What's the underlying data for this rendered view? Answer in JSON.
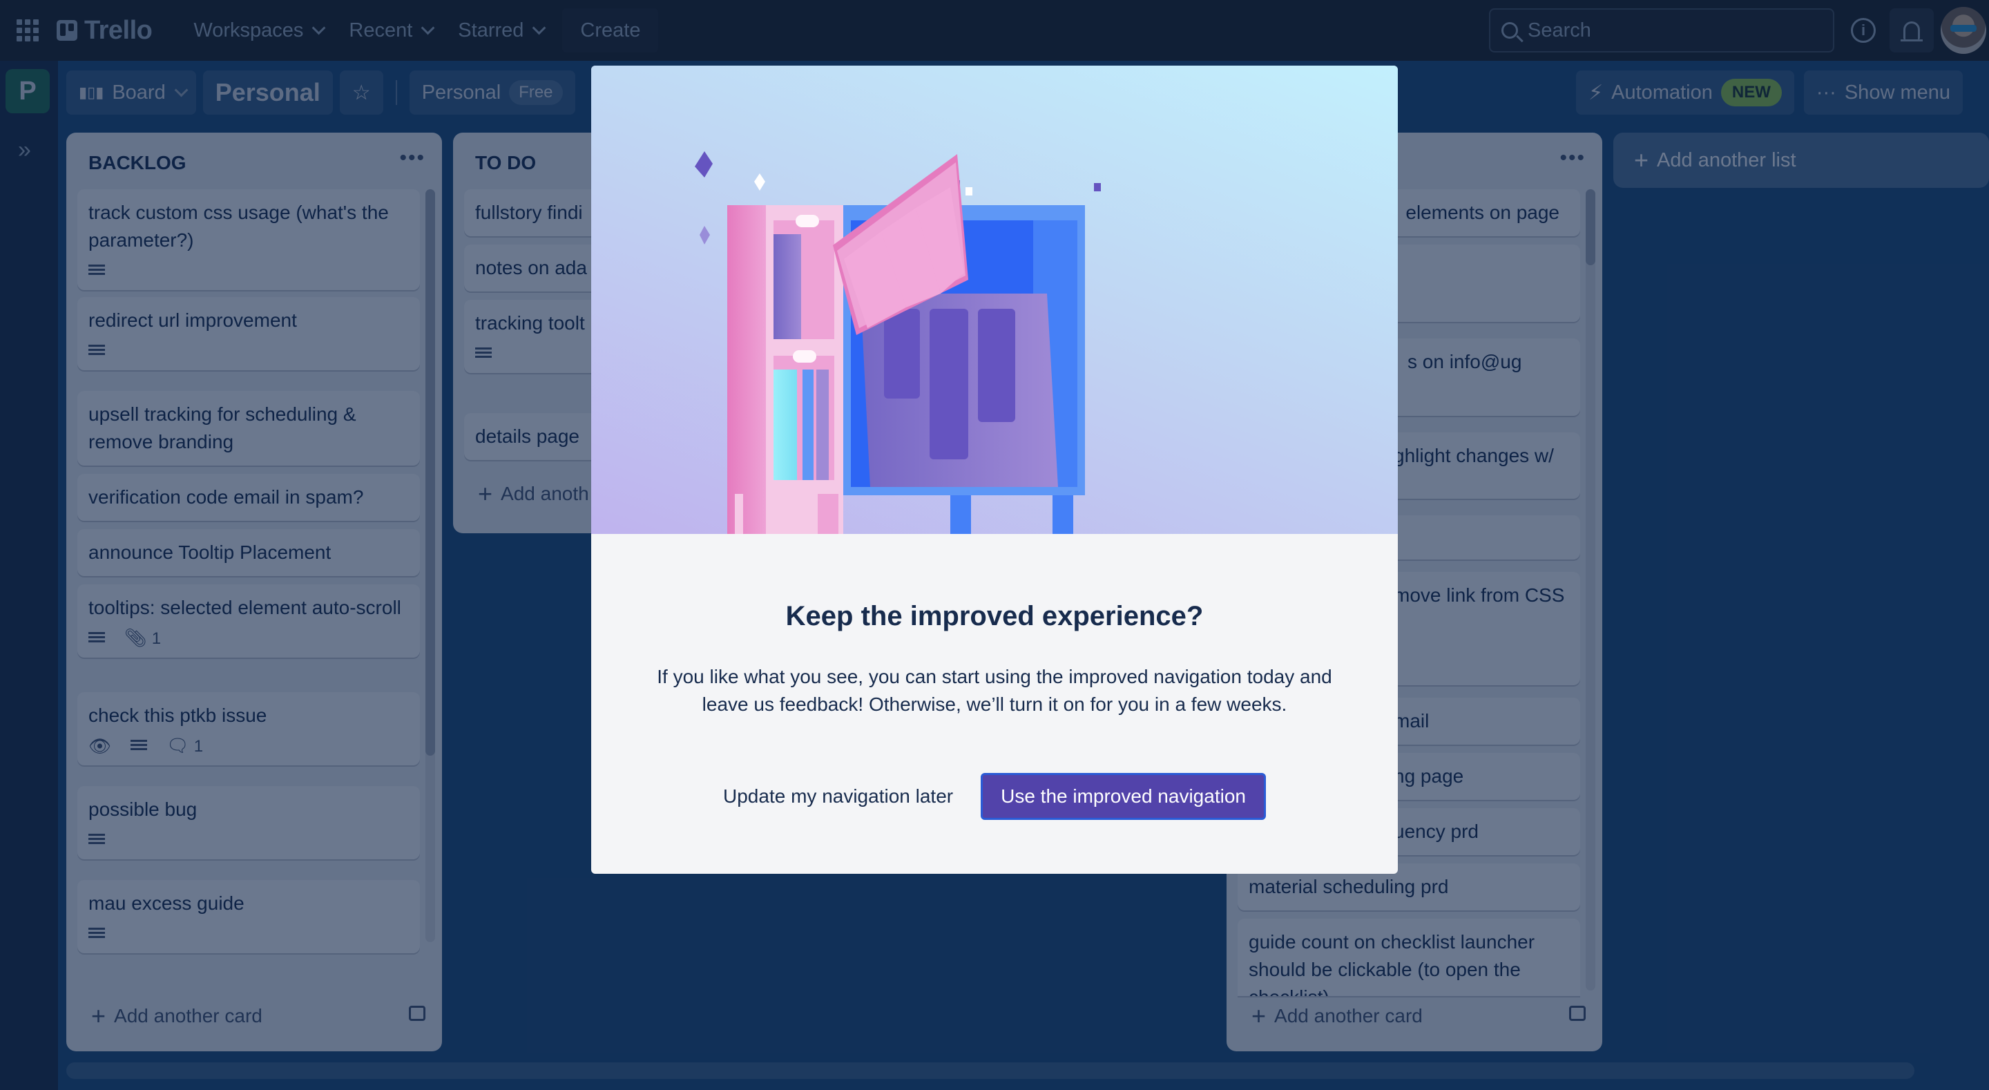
{
  "topbar": {
    "app_name": "Trello",
    "nav": [
      {
        "label": "Workspaces"
      },
      {
        "label": "Recent"
      },
      {
        "label": "Starred"
      }
    ],
    "create_label": "Create",
    "search_placeholder": "Search"
  },
  "workspace": {
    "initial": "P",
    "color": "#216e4e"
  },
  "board_header": {
    "view_label": "Board",
    "title": "Personal",
    "workspace_label": "Personal",
    "plan_badge": "Free",
    "automation_label": "Automation",
    "automation_badge": "NEW",
    "show_menu_label": "Show menu"
  },
  "lists": [
    {
      "title": "BACKLOG",
      "add_card_label": "Add another card",
      "cards": [
        {
          "title": "track custom css usage (what's the parameter?)",
          "has_description": true
        },
        {
          "title": "redirect url improvement",
          "has_description": true
        },
        {
          "title": "upsell tracking for scheduling & remove branding"
        },
        {
          "title": "verification code email in spam?"
        },
        {
          "title": "announce Tooltip Placement"
        },
        {
          "title": "tooltips: selected element auto-scroll",
          "has_description": true,
          "attachments": "1"
        },
        {
          "title": "check this ptkb issue",
          "watching": true,
          "has_description": true,
          "comments": "1"
        },
        {
          "title": "possible bug",
          "has_description": true
        },
        {
          "title": "mau excess guide",
          "has_description": true
        }
      ]
    },
    {
      "title": "TO DO",
      "add_card_label": "Add anoth",
      "cards": [
        {
          "title": "fullstory findi"
        },
        {
          "title": "notes on ada"
        },
        {
          "title": "tracking toolt usage",
          "has_description": true
        },
        {
          "title": "details page "
        }
      ]
    },
    {
      "title": "",
      "add_card_label": "Add another card",
      "cards": [
        {
          "title": "elements on page"
        },
        {
          "title": ""
        },
        {
          "title": "s on info@ug"
        },
        {
          "title": "ghlight changes w/"
        },
        {
          "title": ""
        },
        {
          "title": "move link from CSS"
        },
        {
          "title": "mail"
        },
        {
          "title": "ng page"
        },
        {
          "title": "uency prd"
        },
        {
          "title": "material scheduling prd"
        },
        {
          "title": "guide count on checklist launcher should be clickable (to open the checklist)"
        }
      ]
    }
  ],
  "add_list_label": "Add another list",
  "modal": {
    "title": "Keep the improved experience?",
    "body": "If you like what you see, you can start using the improved navigation today and leave us feedback! Otherwise, we’ll turn it on for you in a few weeks.",
    "secondary_label": "Update my navigation later",
    "primary_label": "Use the improved navigation",
    "primary_color": "#5243aa"
  }
}
